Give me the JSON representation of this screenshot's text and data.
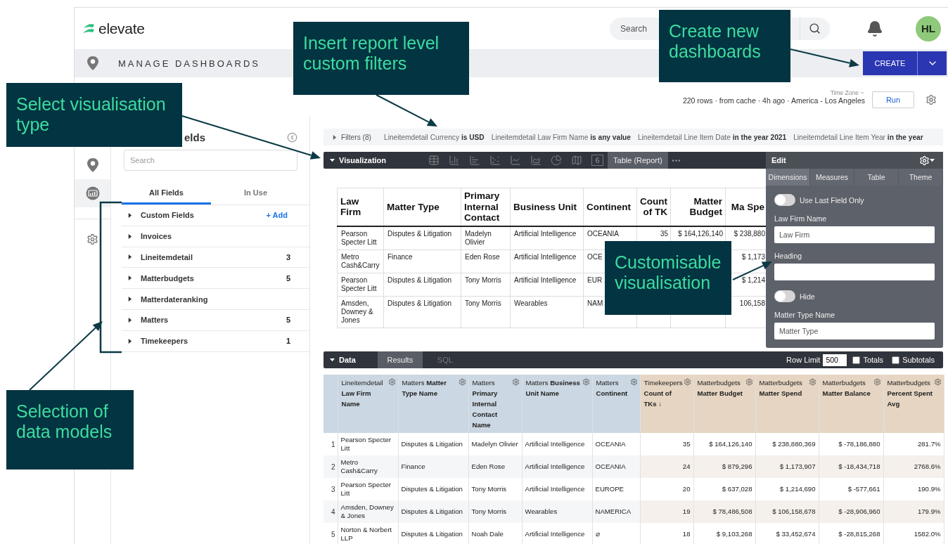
{
  "header": {
    "logo": "elevate",
    "search": {
      "placeholder": "Search"
    },
    "avatar": "HL"
  },
  "page_title": "MANAGE DASHBOARDS",
  "create_button": "CREATE",
  "run_info": {
    "time_zone": "Time Zone",
    "summary": "220 rows · from cache · 4h ago · America - Los Angeles",
    "run_button": "Run"
  },
  "field_panel": {
    "title": "elds",
    "search": {
      "placeholder": "Search"
    },
    "tabs": [
      {
        "label": "All Fields",
        "selected": true
      },
      {
        "label": "In Use",
        "selected": false
      }
    ],
    "groups": [
      {
        "name": "Custom Fields",
        "action": "+ Add"
      },
      {
        "name": "Invoices"
      },
      {
        "name": "Lineitemdetail",
        "count": "3"
      },
      {
        "name": "Matterbudgets",
        "count": "5"
      },
      {
        "name": "Matterdateranking"
      },
      {
        "name": "Matters",
        "count": "5"
      },
      {
        "name": "Timekeepers",
        "count": "1"
      }
    ]
  },
  "filters": {
    "label": "Filters (8)",
    "items": [
      "Lineitemdetail Currency **is USD**",
      "Lineitemdetail Law Firm Name **is any value**",
      "Lineitemdetail Line Item Date **in the year 2021**",
      "Lineitemdetail Line Item Year **in the year**"
    ]
  },
  "visualization": {
    "label": "Visualization",
    "types": [
      {
        "kind": "table"
      },
      {
        "kind": "column"
      },
      {
        "kind": "bar"
      },
      {
        "kind": "scatter"
      },
      {
        "kind": "line"
      },
      {
        "kind": "area"
      },
      {
        "kind": "pie"
      },
      {
        "kind": "map"
      },
      {
        "kind": "single",
        "text": "6"
      }
    ],
    "selected_type": "Table (Report)",
    "table": {
      "columns": [
        {
          "label": "Law Firm",
          "kind": "dimension"
        },
        {
          "label": "Matter Type",
          "kind": "dimension"
        },
        {
          "label": "Primary Internal Contact",
          "kind": "dimension"
        },
        {
          "label": "Business Unit",
          "kind": "dimension"
        },
        {
          "label": "Continent",
          "kind": "dimension"
        },
        {
          "label": "Count of TK",
          "kind": "measure"
        },
        {
          "label": "Matter Budget",
          "kind": "measure"
        },
        {
          "label": "Ma Spe",
          "kind": "measure"
        }
      ],
      "rows": [
        [
          "Pearson Specter Litt",
          "Disputes & Litigation",
          "Madelyn Olivier",
          "Artificial Intelligence",
          "OCEANIA",
          "35",
          "$ 164,126,140",
          "$ 238,880"
        ],
        [
          "Metro Cash&Carry",
          "Finance",
          "Eden Rose",
          "Artificial Intelligence",
          "OCE",
          null,
          null,
          "$ 1,173"
        ],
        [
          "Pearson Specter Litt",
          "Disputes & Litigation",
          "Tony Morris",
          "Artificial Intelligence",
          "EUR",
          null,
          null,
          "$ 1,214"
        ],
        [
          "Amsden, Downey & Jones",
          "Disputes & Litigation",
          "Tony Morris",
          "Wearables",
          "NAM",
          null,
          null,
          "106,158"
        ]
      ]
    }
  },
  "edit_panel": {
    "title": "Edit",
    "tabs": [
      {
        "label": "Dimensions",
        "selected": true
      },
      {
        "label": "Measures",
        "selected": false
      },
      {
        "label": "Table",
        "selected": false
      },
      {
        "label": "Theme",
        "selected": false
      }
    ],
    "fields": [
      {
        "kind": "toggle",
        "label": "Use Last Field Only",
        "on": false
      },
      {
        "kind": "input",
        "label": "Law Firm Name",
        "value": "Law Firm"
      },
      {
        "kind": "input",
        "label": "Heading"
      },
      {
        "kind": "toggle",
        "label": "Hide",
        "on": false
      },
      {
        "kind": "input",
        "label": "Matter Type Name",
        "value": "Matter Type"
      }
    ]
  },
  "data": {
    "label": "Data",
    "tabs": [
      {
        "label": "Results",
        "selected": true
      },
      {
        "label": "SQL",
        "selected": false
      }
    ],
    "row_limit": {
      "label": "Row Limit",
      "value": "500"
    },
    "options": [
      {
        "label": "Totals",
        "checked": false
      },
      {
        "label": "Subtotals",
        "checked": false
      }
    ],
    "columns": [
      {
        "label": "Lineitemdetail **Law Firm Name**",
        "kind": "dimension"
      },
      {
        "label": "Matters **Matter Type Name**",
        "kind": "dimension"
      },
      {
        "label": "Matters **Primary Internal Contact Name**",
        "kind": "dimension"
      },
      {
        "label": "Matters **Business Unit Name**",
        "kind": "dimension"
      },
      {
        "label": "Matters **Continent**",
        "kind": "dimension"
      },
      {
        "label": "Timekeepers **Count of TKs ↓**",
        "kind": "measure"
      },
      {
        "label": "Matterbudgets **Matter Budget**",
        "kind": "measure"
      },
      {
        "label": "Matterbudgets **Matter Spend**",
        "kind": "measure"
      },
      {
        "label": "Matterbudgets **Matter Balance**",
        "kind": "measure"
      },
      {
        "label": "Matterbudgets **Percent Spent Avg**",
        "kind": "measure"
      }
    ],
    "rows": [
      {
        "num": "1",
        "cells": [
          "Pearson Specter Litt",
          "Disputes & Litigation",
          "Madelyn Olivier",
          "Artificial Intelligence",
          "OCEANIA",
          "35",
          "$ 164,126,140",
          "$ 238,880,369",
          "$ -78,186,880",
          "281.7%"
        ]
      },
      {
        "num": "2",
        "cells": [
          "Metro Cash&Carry",
          "Finance",
          "Eden Rose",
          "Artificial Intelligence",
          "OCEANIA",
          "24",
          "$ 879,296",
          "$ 1,173,907",
          "$ -18,434,718",
          "2768.6%"
        ]
      },
      {
        "num": "3",
        "cells": [
          "Pearson Specter Litt",
          "Disputes & Litigation",
          "Tony Morris",
          "Artificial Intelligence",
          "EUROPE",
          "20",
          "$ 637,028",
          "$ 1,214,690",
          "$ -577,661",
          "190.9%"
        ]
      },
      {
        "num": "4",
        "cells": [
          "Amsden, Downey & Jones",
          "Disputes & Litigation",
          "Tony Morris",
          "Wearables",
          "NAMERICA",
          "19",
          "$ 78,486,508",
          "$ 106,158,678",
          "$ -28,906,960",
          "179.9%"
        ]
      },
      {
        "num": "5",
        "cells": [
          "Norton & Norbert LLP",
          "Disputes & Litigation",
          "Noah Dale",
          "Artificial Intelligence",
          "⌀",
          "18",
          "$ 9,103,268",
          "$ 33,452,674",
          "$ -28,815,268",
          "1582.0%"
        ]
      }
    ]
  },
  "callouts": [
    {
      "text": "Insert report level custom filters"
    },
    {
      "text": "Create new dashboards"
    },
    {
      "text": "Select visualisation type"
    },
    {
      "text": "Customisable visualisation"
    },
    {
      "text": "Selection of data models"
    }
  ]
}
